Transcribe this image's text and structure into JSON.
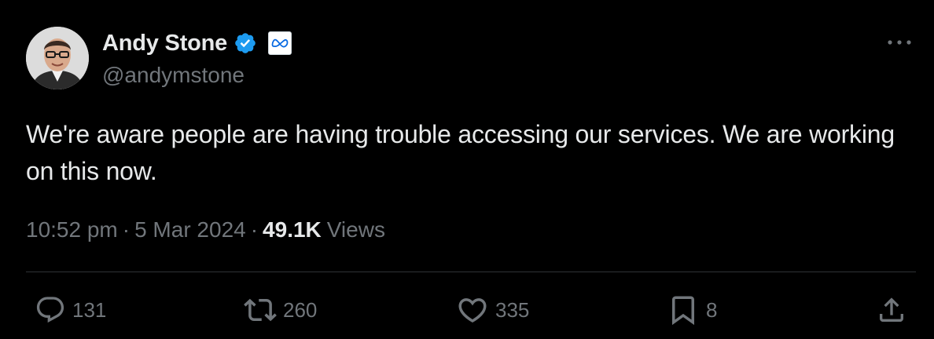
{
  "author": {
    "display_name": "Andy Stone",
    "handle": "@andymstone",
    "verified": true,
    "affiliate_org": "Meta",
    "verified_color": "#1d9bf0"
  },
  "tweet": {
    "text": "We're aware people are having trouble accessing our services. We are working on this now.",
    "time": "10:52 pm",
    "separator": "·",
    "date": "5 Mar 2024",
    "views_count": "49.1K",
    "views_label": "Views"
  },
  "actions": {
    "reply": {
      "icon": "reply-icon",
      "count": "131"
    },
    "retweet": {
      "icon": "retweet-icon",
      "count": "260"
    },
    "like": {
      "icon": "heart-icon",
      "count": "335"
    },
    "bookmark": {
      "icon": "bookmark-icon",
      "count": "8"
    },
    "share": {
      "icon": "share-icon"
    }
  },
  "colors": {
    "background": "#000000",
    "primary_text": "#e7e9ea",
    "secondary_text": "#71767b",
    "divider": "#2f3336"
  }
}
